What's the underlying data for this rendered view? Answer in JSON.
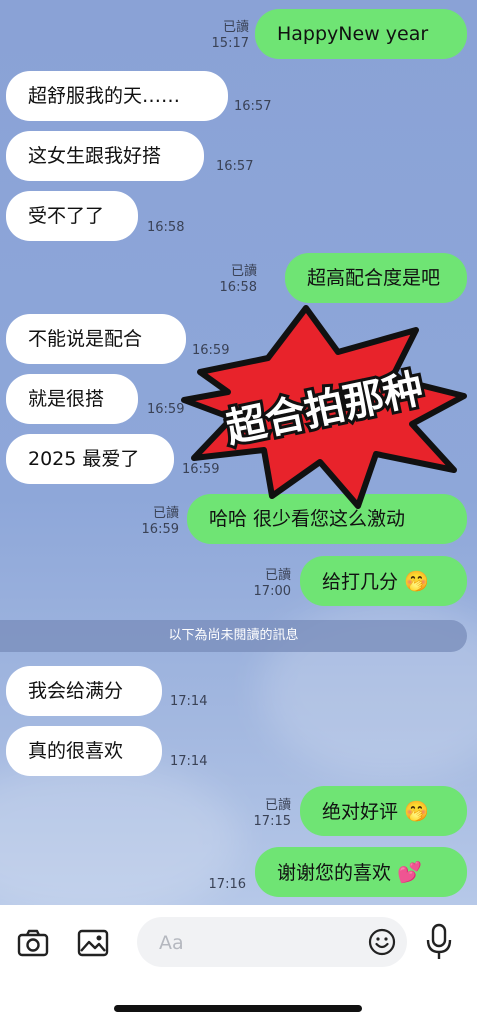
{
  "messages": [
    {
      "side": "out",
      "text": "HappyNew year",
      "read": "已讀",
      "time": "15:17"
    },
    {
      "side": "in",
      "text": "超舒服我的天……",
      "time": "16:57"
    },
    {
      "side": "in",
      "text": "这女生跟我好搭",
      "time": "16:57"
    },
    {
      "side": "in",
      "text": "受不了了",
      "time": "16:58"
    },
    {
      "side": "out",
      "text": "超高配合度是吧",
      "read": "已讀",
      "time": "16:58"
    },
    {
      "side": "in",
      "text": "不能说是配合",
      "time": "16:59"
    },
    {
      "side": "in",
      "text": "就是很搭",
      "time": "16:59"
    },
    {
      "side": "in",
      "text": "2025 最爱了",
      "time": "16:59"
    },
    {
      "side": "out",
      "text": "哈哈 很少看您这么激动",
      "read": "已讀",
      "time": "16:59"
    },
    {
      "side": "out",
      "text": "给打几分",
      "emoji": "🤭",
      "read": "已讀",
      "time": "17:00"
    },
    {
      "side": "in",
      "text": "我会给满分",
      "time": "17:14"
    },
    {
      "side": "in",
      "text": "真的很喜欢",
      "time": "17:14"
    },
    {
      "side": "out",
      "text": "绝对好评",
      "emoji": "🤭",
      "read": "已讀",
      "time": "17:15"
    },
    {
      "side": "out",
      "text": "谢谢您的喜欢",
      "emoji": "💕",
      "time": "17:16"
    }
  ],
  "unread_divider": "以下為尚未閱讀的訊息",
  "sticker_text": "超合拍那种",
  "input": {
    "placeholder": "Aa",
    "value": ""
  },
  "icons": {
    "camera": "camera-icon",
    "image": "image-icon",
    "emoji": "emoji-icon",
    "mic": "microphone-icon"
  },
  "colors": {
    "out_bubble": "#6fe474",
    "in_bubble": "#ffffff",
    "burst": "#e8232b"
  }
}
